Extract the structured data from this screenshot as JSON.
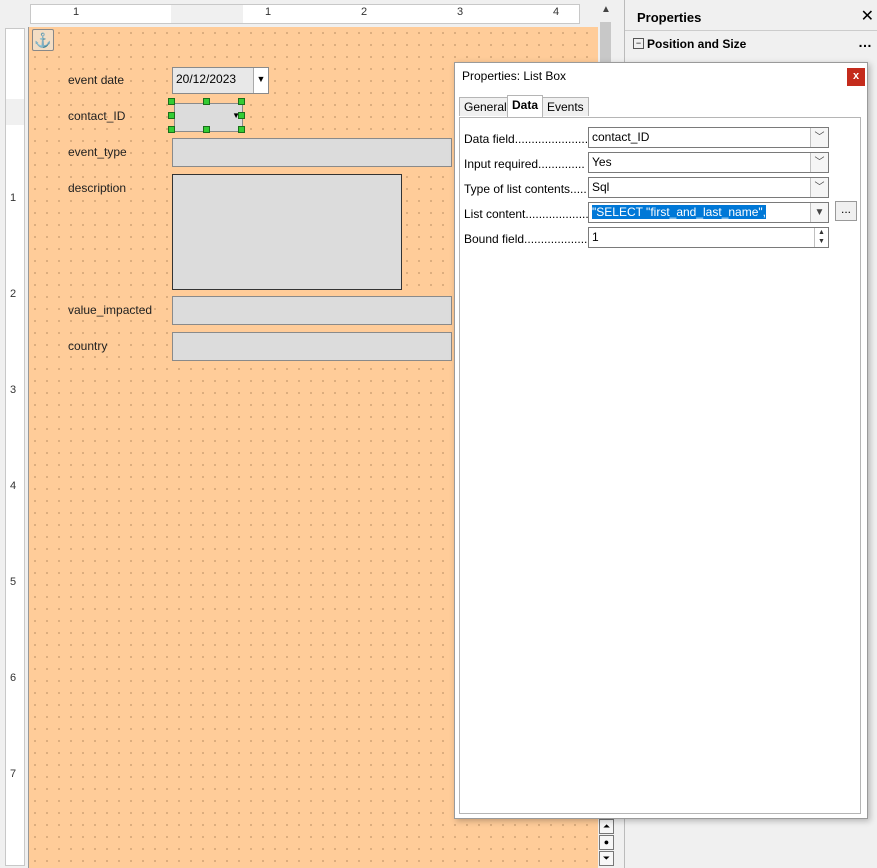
{
  "rulers": {
    "horizontal_ticks": [
      "1",
      "1",
      "2",
      "3",
      "4"
    ],
    "vertical_ticks": [
      "1",
      "2",
      "3",
      "4",
      "5",
      "6",
      "7"
    ]
  },
  "form": {
    "fields": [
      {
        "label": "event date",
        "value": "20/12/2023"
      },
      {
        "label": "contact_ID"
      },
      {
        "label": "event_type"
      },
      {
        "label": "description"
      },
      {
        "label": "value_impacted"
      },
      {
        "label": "country"
      }
    ]
  },
  "sidebar": {
    "title": "Properties",
    "close": "✕",
    "section": "Position and Size",
    "more": "…"
  },
  "dialog": {
    "title": "Properties: List Box",
    "close": "x",
    "tabs": [
      "General",
      "Data",
      "Events"
    ],
    "active_tab": "Data",
    "rows": [
      {
        "label": "Data field......................",
        "value": "contact_ID"
      },
      {
        "label": "Input required..............",
        "value": "Yes"
      },
      {
        "label": "Type of list contents.....",
        "value": "Sql"
      },
      {
        "label": "List content....................",
        "value": "\"SELECT \"first_and_last_name\","
      },
      {
        "label": "Bound field.....................",
        "value": "1"
      }
    ],
    "ellipsis_button": "..."
  },
  "colors": {
    "canvas": "#ffcc99",
    "selection": "#0078d7",
    "handle": "#33cc33",
    "close_button": "#c42b1c"
  }
}
